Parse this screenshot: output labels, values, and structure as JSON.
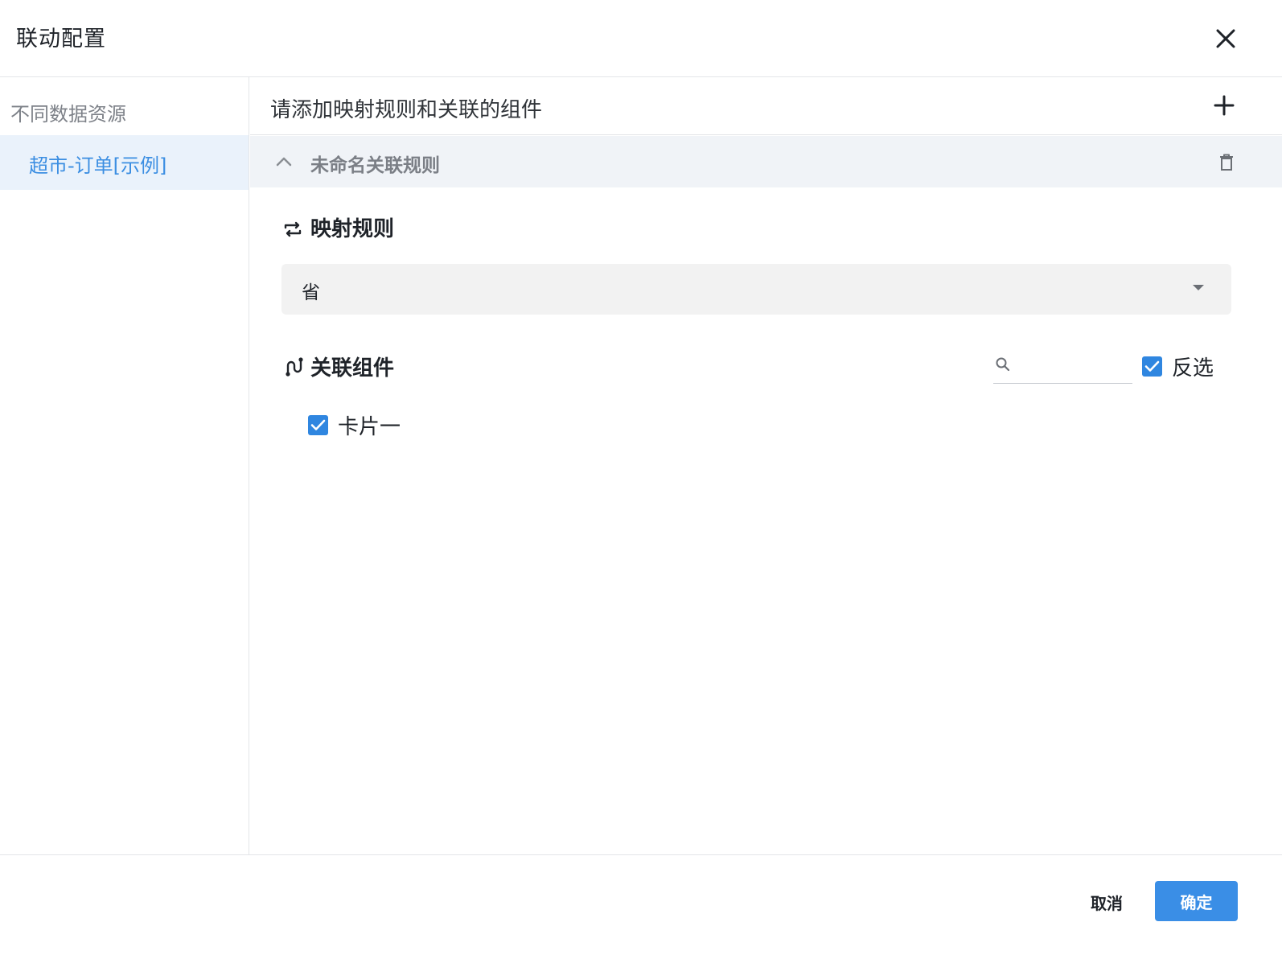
{
  "dialog": {
    "title": "联动配置"
  },
  "sidebar": {
    "heading": "不同数据资源",
    "items": [
      {
        "label": "超市-订单[示例]",
        "selected": true
      }
    ]
  },
  "main": {
    "hint": "请添加映射规则和关联的组件",
    "rule": {
      "name": "未命名关联规则",
      "mapping_title": "映射规则",
      "mapping_field": "省",
      "components_title": "关联组件",
      "search_placeholder": "",
      "invert_label": "反选",
      "invert_checked": true,
      "components": [
        {
          "label": "卡片一",
          "checked": true
        }
      ]
    }
  },
  "footer": {
    "cancel_label": "取消",
    "ok_label": "确定"
  },
  "colors": {
    "accent": "#3a8ee6",
    "selected_bg": "#eaf2fb",
    "rule_header_bg": "#f0f3f7"
  },
  "icons": [
    "close-icon",
    "plus-icon",
    "chevron-up-icon",
    "trash-icon",
    "swap-icon",
    "link-icon",
    "search-icon",
    "check-icon",
    "caret-down-icon"
  ]
}
